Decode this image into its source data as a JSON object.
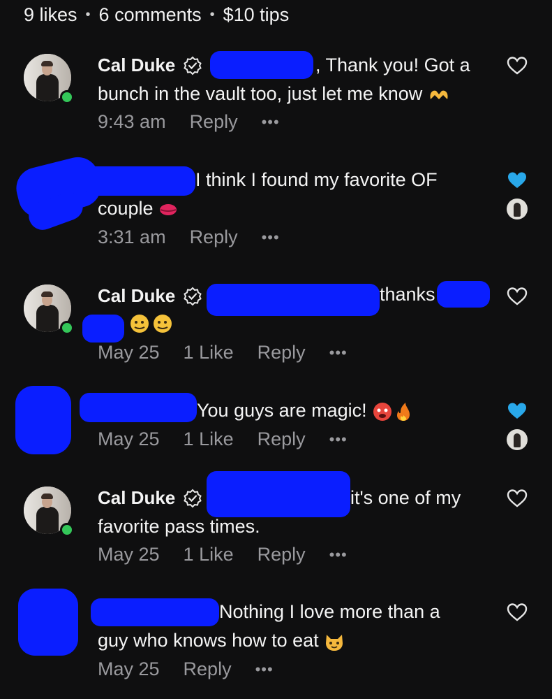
{
  "stats": {
    "likes": "9 likes",
    "comments": "6 comments",
    "tips": "$10 tips",
    "separator": "•"
  },
  "comments": [
    {
      "name": "Cal Duke",
      "line1": ", Thank you! Got a",
      "line2": "bunch in the vault too, just let me know",
      "time": "9:43 am",
      "reply": "Reply",
      "more": "•••",
      "liked": false
    },
    {
      "line1": "I think I found my favorite OF",
      "line2": "couple",
      "time": "3:31 am",
      "reply": "Reply",
      "more": "•••",
      "liked": true
    },
    {
      "name": "Cal Duke",
      "line1": "thanks",
      "time": "May 25",
      "likes": "1 Like",
      "reply": "Reply",
      "more": "•••",
      "liked": false
    },
    {
      "line1": "You guys are magic!",
      "time": "May 25",
      "likes": "1 Like",
      "reply": "Reply",
      "more": "•••",
      "liked": true
    },
    {
      "name": "Cal Duke",
      "line1": "it's one of my",
      "line2": "favorite pass times.",
      "time": "May 25",
      "likes": "1 Like",
      "reply": "Reply",
      "more": "•••",
      "liked": false
    },
    {
      "line1": "Nothing I love more than a",
      "line2": "guy who knows how to eat",
      "time": "May 25",
      "reply": "Reply",
      "more": "•••",
      "liked": false
    }
  ],
  "icons": {
    "heart_outline": "heart-outline-icon",
    "heart_filled": "heart-filled-icon",
    "verified": "verified-badge-icon",
    "more": "more-options-icon"
  },
  "colors": {
    "background": "#0f0f10",
    "liked_heart": "#29a8ea",
    "meta": "#9a9a9e",
    "online": "#34c759",
    "redaction": "#0a1eff"
  }
}
